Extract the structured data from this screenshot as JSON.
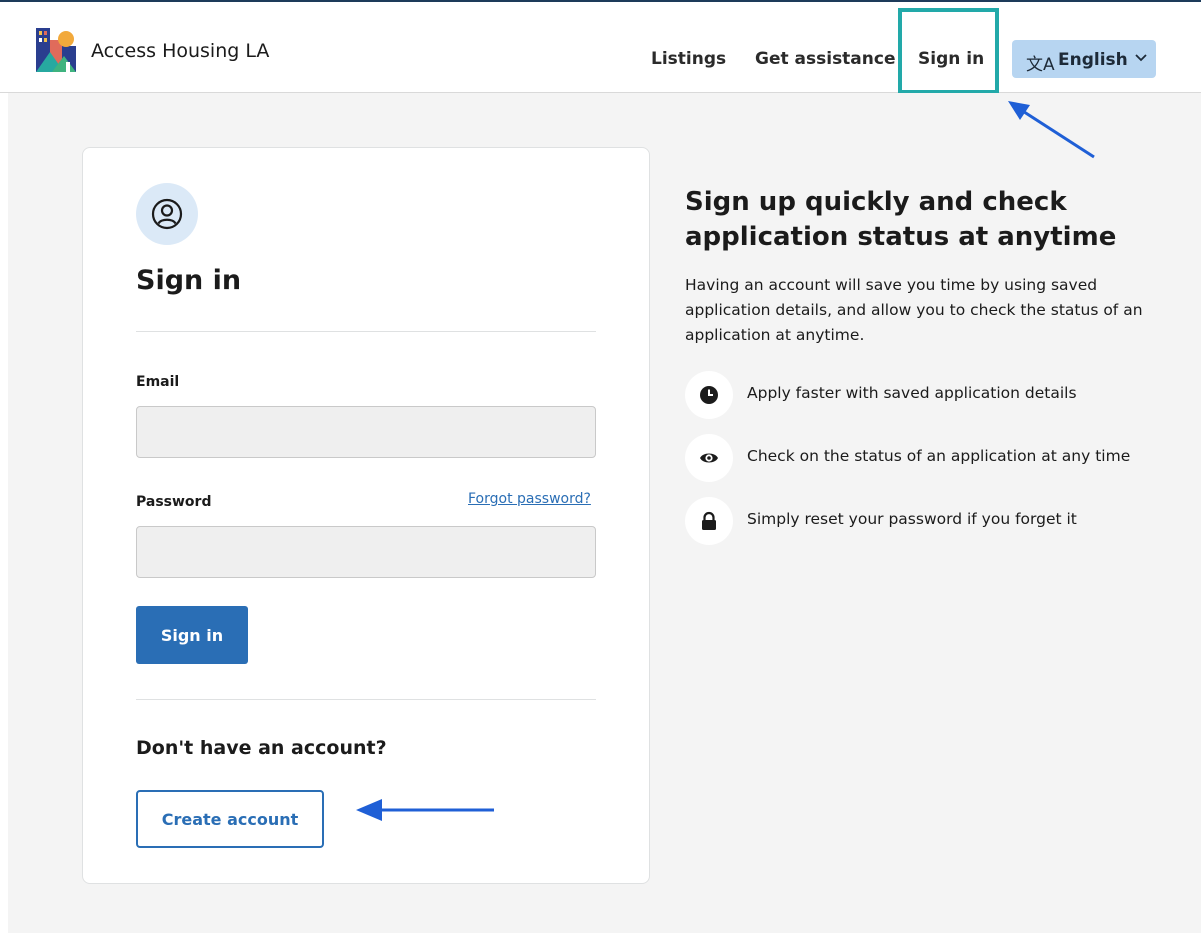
{
  "header": {
    "brand": "Access Housing LA",
    "nav": {
      "listings": "Listings",
      "get_assistance": "Get assistance",
      "sign_in": "Sign in"
    },
    "language": {
      "icon": "translate-icon",
      "label": "English"
    }
  },
  "signin_card": {
    "title": "Sign in",
    "email_label": "Email",
    "email_value": "",
    "password_label": "Password",
    "password_value": "",
    "forgot_password": "Forgot password?",
    "submit_label": "Sign in",
    "no_account_heading": "Don't have an account?",
    "create_account_label": "Create account"
  },
  "promo": {
    "title": "Sign up quickly and check application status at anytime",
    "description": "Having an account will save you time by using saved application details, and allow you to check the status of an application at anytime.",
    "benefits": [
      {
        "icon": "clock-icon",
        "text": "Apply faster with saved application details"
      },
      {
        "icon": "eye-icon",
        "text": "Check on the status of an application at any time"
      },
      {
        "icon": "lock-icon",
        "text": "Simply reset your password if you forget it"
      }
    ]
  },
  "colors": {
    "primary": "#2a6eb5",
    "highlight": "#22a9a9",
    "annotation_arrow": "#1f5fd6",
    "language_bg": "#b7d5f1",
    "page_bg": "#f4f4f4"
  }
}
